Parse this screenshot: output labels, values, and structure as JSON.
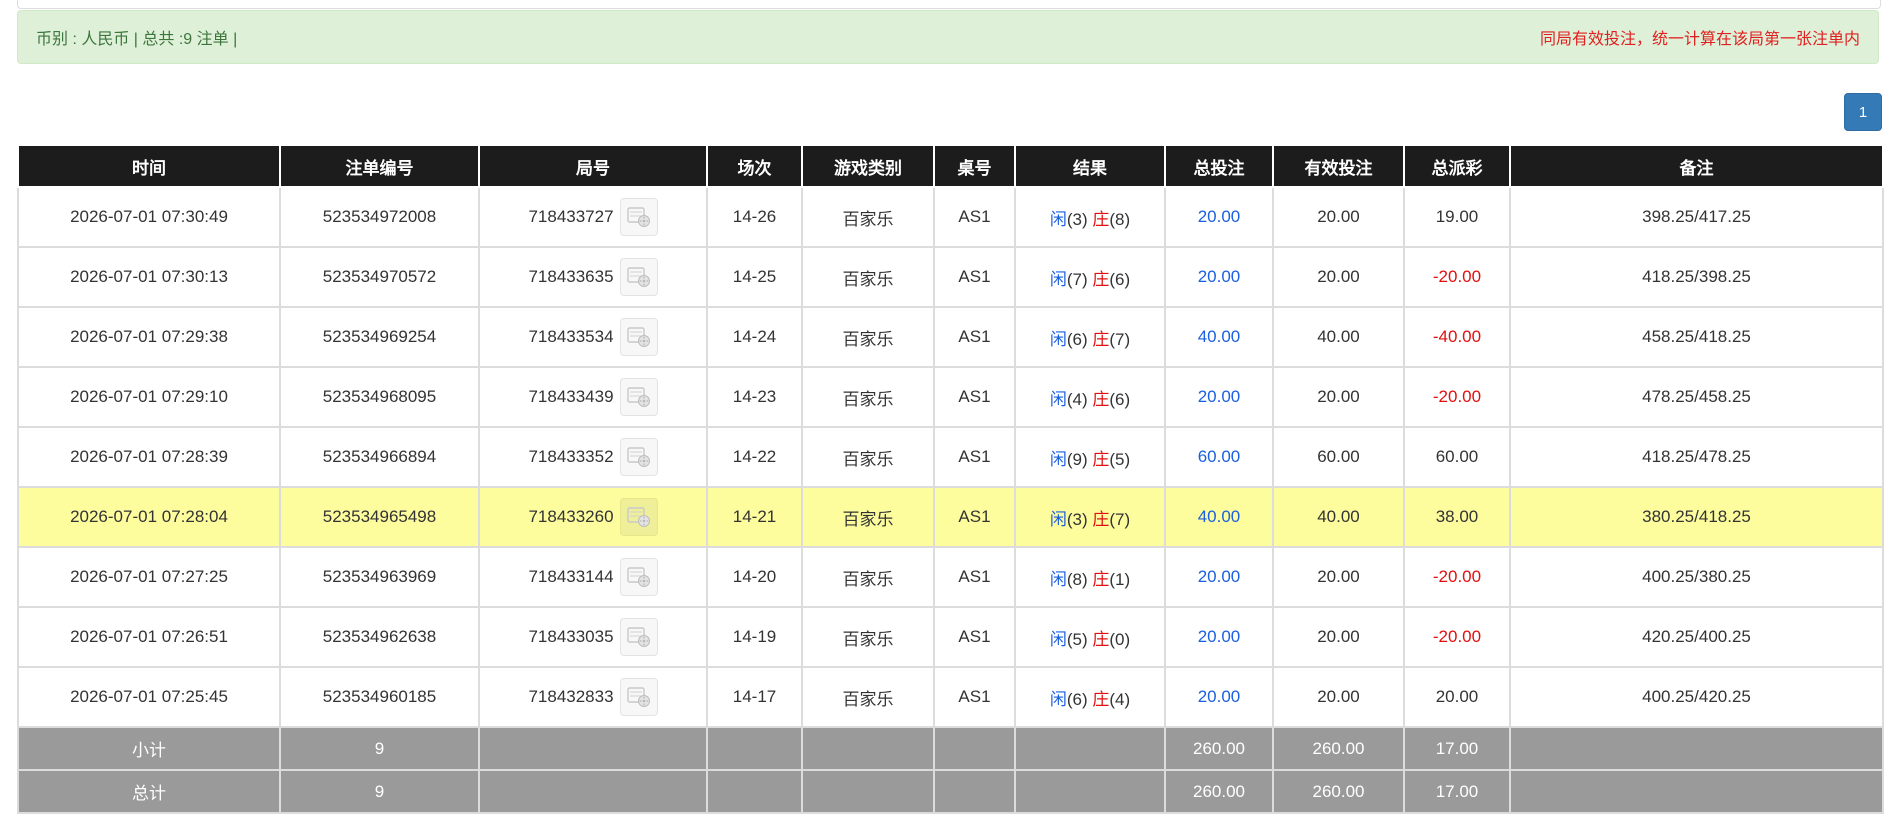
{
  "info": {
    "left": "币别 : 人民币 | 总共 :9 注单 |",
    "right": "同局有效投注，统一计算在该局第一张注单内"
  },
  "pager": {
    "page": "1"
  },
  "headers": [
    "时间",
    "注单编号",
    "局号",
    "场次",
    "游戏类别",
    "桌号",
    "结果",
    "总投注",
    "有效投注",
    "总派彩",
    "备注"
  ],
  "rows": [
    {
      "time": "2026-07-01 07:30:49",
      "order": "523534972008",
      "round": "718433727",
      "session": "14-26",
      "game": "百家乐",
      "table": "AS1",
      "player_label": "闲",
      "player": "(3)",
      "banker_label": "庄",
      "banker": "(8)",
      "total": "20.00",
      "valid": "20.00",
      "payout": "19.00",
      "payout_neg": false,
      "note": "398.25/417.25",
      "highlight": false
    },
    {
      "time": "2026-07-01 07:30:13",
      "order": "523534970572",
      "round": "718433635",
      "session": "14-25",
      "game": "百家乐",
      "table": "AS1",
      "player_label": "闲",
      "player": "(7)",
      "banker_label": "庄",
      "banker": "(6)",
      "total": "20.00",
      "valid": "20.00",
      "payout": "-20.00",
      "payout_neg": true,
      "note": "418.25/398.25",
      "highlight": false
    },
    {
      "time": "2026-07-01 07:29:38",
      "order": "523534969254",
      "round": "718433534",
      "session": "14-24",
      "game": "百家乐",
      "table": "AS1",
      "player_label": "闲",
      "player": "(6)",
      "banker_label": "庄",
      "banker": "(7)",
      "total": "40.00",
      "valid": "40.00",
      "payout": "-40.00",
      "payout_neg": true,
      "note": "458.25/418.25",
      "highlight": false
    },
    {
      "time": "2026-07-01 07:29:10",
      "order": "523534968095",
      "round": "718433439",
      "session": "14-23",
      "game": "百家乐",
      "table": "AS1",
      "player_label": "闲",
      "player": "(4)",
      "banker_label": "庄",
      "banker": "(6)",
      "total": "20.00",
      "valid": "20.00",
      "payout": "-20.00",
      "payout_neg": true,
      "note": "478.25/458.25",
      "highlight": false
    },
    {
      "time": "2026-07-01 07:28:39",
      "order": "523534966894",
      "round": "718433352",
      "session": "14-22",
      "game": "百家乐",
      "table": "AS1",
      "player_label": "闲",
      "player": "(9)",
      "banker_label": "庄",
      "banker": "(5)",
      "total": "60.00",
      "valid": "60.00",
      "payout": "60.00",
      "payout_neg": false,
      "note": "418.25/478.25",
      "highlight": false
    },
    {
      "time": "2026-07-01 07:28:04",
      "order": "523534965498",
      "round": "718433260",
      "session": "14-21",
      "game": "百家乐",
      "table": "AS1",
      "player_label": "闲",
      "player": "(3)",
      "banker_label": "庄",
      "banker": "(7)",
      "total": "40.00",
      "valid": "40.00",
      "payout": "38.00",
      "payout_neg": false,
      "note": "380.25/418.25",
      "highlight": true
    },
    {
      "time": "2026-07-01 07:27:25",
      "order": "523534963969",
      "round": "718433144",
      "session": "14-20",
      "game": "百家乐",
      "table": "AS1",
      "player_label": "闲",
      "player": "(8)",
      "banker_label": "庄",
      "banker": "(1)",
      "total": "20.00",
      "valid": "20.00",
      "payout": "-20.00",
      "payout_neg": true,
      "note": "400.25/380.25",
      "highlight": false
    },
    {
      "time": "2026-07-01 07:26:51",
      "order": "523534962638",
      "round": "718433035",
      "session": "14-19",
      "game": "百家乐",
      "table": "AS1",
      "player_label": "闲",
      "player": "(5)",
      "banker_label": "庄",
      "banker": "(0)",
      "total": "20.00",
      "valid": "20.00",
      "payout": "-20.00",
      "payout_neg": true,
      "note": "420.25/400.25",
      "highlight": false
    },
    {
      "time": "2026-07-01 07:25:45",
      "order": "523534960185",
      "round": "718432833",
      "session": "14-17",
      "game": "百家乐",
      "table": "AS1",
      "player_label": "闲",
      "player": "(6)",
      "banker_label": "庄",
      "banker": "(4)",
      "total": "20.00",
      "valid": "20.00",
      "payout": "20.00",
      "payout_neg": false,
      "note": "400.25/420.25",
      "highlight": false
    }
  ],
  "subtotal": {
    "label": "小计",
    "count": "9",
    "total": "260.00",
    "valid": "260.00",
    "payout": "17.00"
  },
  "grandtotal": {
    "label": "总计",
    "count": "9",
    "total": "260.00",
    "valid": "260.00",
    "payout": "17.00"
  },
  "colors": {
    "blue": "#1a5fe0",
    "red": "#e01010",
    "highlight": "#fdfd9e",
    "header": "#1c1c1c",
    "footer": "#9a9a9a"
  },
  "icons": {
    "round_video": "video-icon"
  }
}
